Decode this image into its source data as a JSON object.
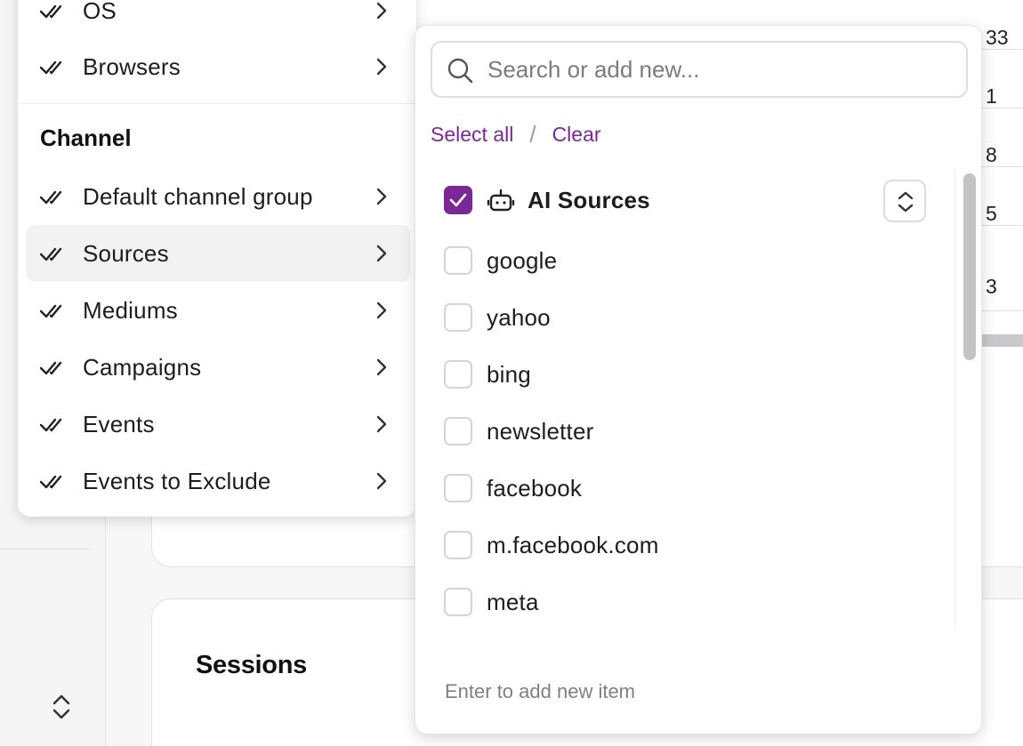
{
  "menu": {
    "top_items": [
      {
        "label": "OS"
      },
      {
        "label": "Browsers"
      }
    ],
    "section_title": "Channel",
    "channel_items": [
      {
        "label": "Default channel group"
      },
      {
        "label": "Sources"
      },
      {
        "label": "Mediums"
      },
      {
        "label": "Campaigns"
      },
      {
        "label": "Events"
      },
      {
        "label": "Events to Exclude"
      }
    ]
  },
  "dropdown": {
    "search_placeholder": "Search or add new...",
    "search_value": "",
    "select_all_label": "Select all",
    "separator": "/",
    "clear_label": "Clear",
    "group_option": {
      "label": "AI Sources",
      "checked": true
    },
    "options": [
      {
        "label": "google",
        "checked": false
      },
      {
        "label": "yahoo",
        "checked": false
      },
      {
        "label": "bing",
        "checked": false
      },
      {
        "label": "newsletter",
        "checked": false
      },
      {
        "label": "facebook",
        "checked": false
      },
      {
        "label": "m.facebook.com",
        "checked": false
      },
      {
        "label": "meta",
        "checked": false
      }
    ],
    "hint": "Enter to add new item"
  },
  "background": {
    "table_numbers": [
      "33",
      "1",
      "8",
      "5",
      "3"
    ],
    "card_title": "Sessions"
  },
  "colors": {
    "accent": "#7b2896",
    "active_menu_bg": "#f2f2f3"
  }
}
